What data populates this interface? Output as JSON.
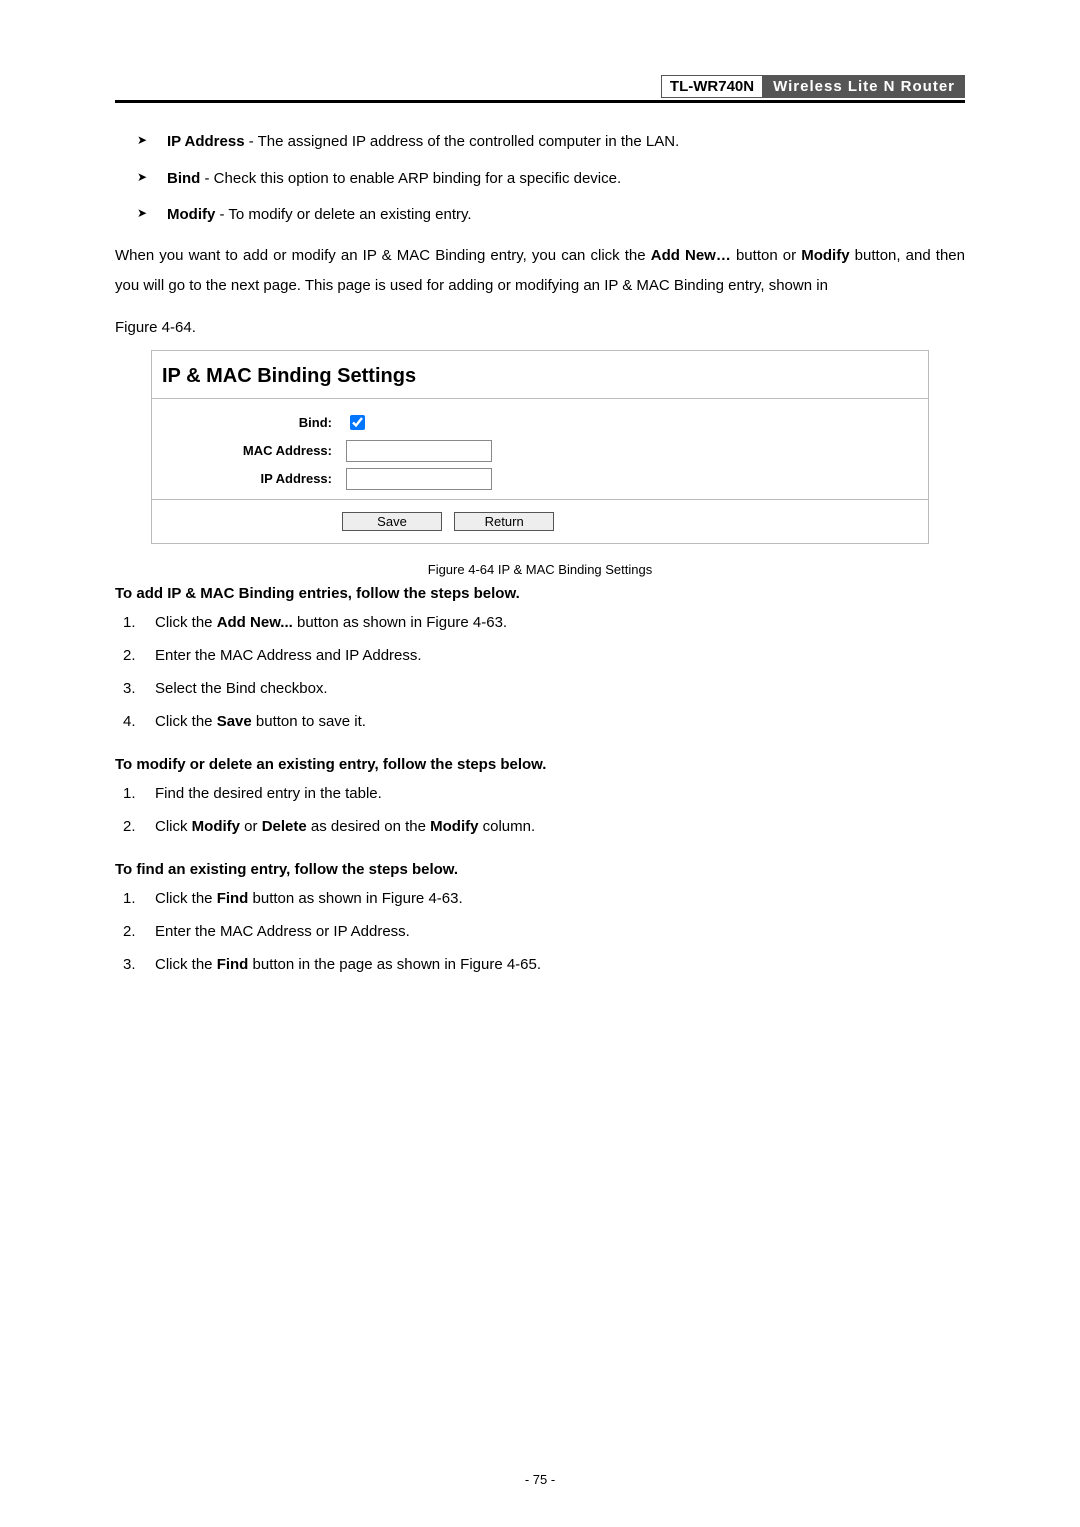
{
  "header": {
    "model": "TL-WR740N",
    "tagline": "Wireless Lite N Router"
  },
  "bullets": [
    {
      "term": "IP Address",
      "sep": " - ",
      "desc": "The assigned IP address of the controlled computer in the LAN."
    },
    {
      "term": "Bind",
      "sep": " - ",
      "desc": "Check this option to enable ARP binding for a specific device."
    },
    {
      "term": "Modify",
      "sep": " - ",
      "desc": "To modify or delete an existing entry."
    }
  ],
  "para_pre": "When you want to add or modify an IP & MAC Binding entry, you can click the ",
  "para_addnew": "Add New…",
  "para_mid1": " button or ",
  "para_modify": "Modify",
  "para_mid2": " button, and then you will go to the next page. This page is used for adding or modifying an IP & MAC Binding entry, shown in",
  "figref": "Figure 4-64.",
  "settings": {
    "title": "IP & MAC Binding Settings",
    "labels": {
      "bind": "Bind:",
      "mac": "MAC Address:",
      "ip": "IP Address:"
    },
    "buttons": {
      "save": "Save",
      "return": "Return"
    },
    "values": {
      "mac": "",
      "ip": ""
    }
  },
  "figcap": "Figure 4-64 IP & MAC Binding Settings",
  "section_add_head": "To add IP & MAC Binding entries, follow the steps below.",
  "steps_add": [
    {
      "pre": "Click the ",
      "bold": "Add New...",
      "post": " button as shown in Figure 4-63."
    },
    {
      "pre": "Enter the MAC Address and IP Address.",
      "bold": "",
      "post": ""
    },
    {
      "pre": "Select the Bind checkbox.",
      "bold": "",
      "post": ""
    },
    {
      "pre": "Click the ",
      "bold": "Save",
      "post": " button to save it."
    }
  ],
  "section_mod_head": "To modify or delete an existing entry, follow the steps below.",
  "steps_mod": [
    {
      "text": "Find the desired entry in the table."
    },
    {
      "pre": "Click ",
      "b1": "Modify",
      "mid": " or ",
      "b2": "Delete",
      "mid2": " as desired on the ",
      "b3": "Modify",
      "post": " column."
    }
  ],
  "section_find_head": "To find an existing entry, follow the steps below.",
  "steps_find": [
    {
      "pre": "Click the ",
      "bold": "Find",
      "post": " button as shown in Figure 4-63."
    },
    {
      "pre": "Enter the MAC Address or IP Address.",
      "bold": "",
      "post": ""
    },
    {
      "pre": "Click the ",
      "bold": "Find",
      "post": " button in the page as shown in Figure 4-65."
    }
  ],
  "page_number": "- 75 -"
}
